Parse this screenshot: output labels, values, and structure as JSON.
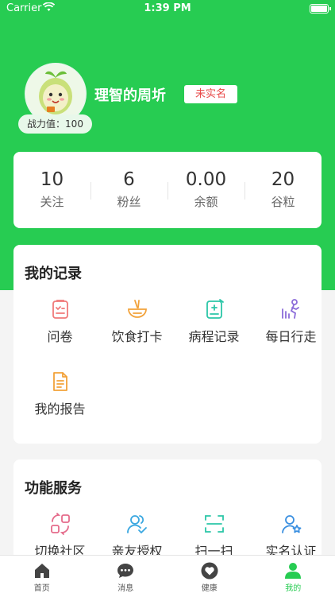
{
  "status_bar": {
    "carrier": "Carrier",
    "time": "1:39 PM"
  },
  "profile": {
    "username": "理智的周圻",
    "verify_badge": "未实名",
    "power_label": "战力值：100"
  },
  "stats": [
    {
      "value": "10",
      "label": "关注"
    },
    {
      "value": "6",
      "label": "粉丝"
    },
    {
      "value": "0.00",
      "label": "余额"
    },
    {
      "value": "20",
      "label": "谷粒"
    }
  ],
  "records": {
    "title": "我的记录",
    "items": [
      {
        "label": "问卷",
        "icon": "questionnaire-icon",
        "color": "#f07a7a"
      },
      {
        "label": "饮食打卡",
        "icon": "food-bowl-icon",
        "color": "#f2a23a"
      },
      {
        "label": "病程记录",
        "icon": "medical-record-icon",
        "color": "#2bc6a8"
      },
      {
        "label": "每日行走",
        "icon": "walking-icon",
        "color": "#8b6cd9"
      },
      {
        "label": "我的报告",
        "icon": "report-icon",
        "color": "#f2a23a"
      }
    ]
  },
  "services": {
    "title": "功能服务",
    "items": [
      {
        "label": "切换社区",
        "icon": "switch-community-icon",
        "color": "#e56b8b"
      },
      {
        "label": "亲友授权",
        "icon": "family-auth-icon",
        "color": "#3aa7e0"
      },
      {
        "label": "扫一扫",
        "icon": "scan-icon",
        "color": "#2bc6a8"
      },
      {
        "label": "实名认证",
        "icon": "identity-verify-icon",
        "color": "#3a8fe0"
      }
    ]
  },
  "tab_bar": [
    {
      "label": "首页",
      "icon": "home-icon"
    },
    {
      "label": "消息",
      "icon": "message-icon"
    },
    {
      "label": "健康",
      "icon": "health-heart-icon"
    },
    {
      "label": "我的",
      "icon": "profile-icon",
      "active": true
    }
  ],
  "colors": {
    "brand_green": "#27cc52",
    "badge_red": "#e84a4a"
  }
}
